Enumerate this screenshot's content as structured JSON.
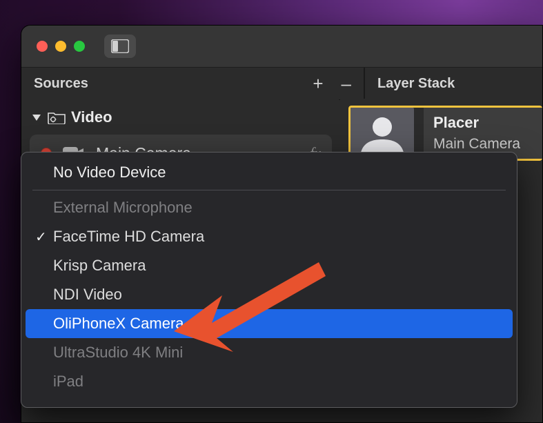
{
  "panels": {
    "sources": {
      "title": "Sources",
      "actions": {
        "add": "+",
        "remove": "–"
      },
      "group": {
        "label": "Video"
      },
      "item": {
        "label": "Main Camera",
        "fx": "fx"
      }
    },
    "layer_stack": {
      "title": "Layer Stack",
      "item": {
        "title": "Placer",
        "subtitle": "Main Camera"
      }
    }
  },
  "menu": {
    "top": "No Video Device",
    "items": [
      {
        "label": "External Microphone",
        "state": "disabled"
      },
      {
        "label": "FaceTime HD Camera",
        "state": "checked"
      },
      {
        "label": "Krisp Camera",
        "state": "normal"
      },
      {
        "label": "NDI Video",
        "state": "normal"
      },
      {
        "label": "OliPhoneX Camera",
        "state": "highlight"
      },
      {
        "label": "UltraStudio 4K Mini",
        "state": "disabled"
      },
      {
        "label": "iPad",
        "state": "disabled"
      }
    ]
  },
  "colors": {
    "highlight": "#1e66e5",
    "selection_border": "#f3c43e",
    "arrow": "#e8522e"
  }
}
